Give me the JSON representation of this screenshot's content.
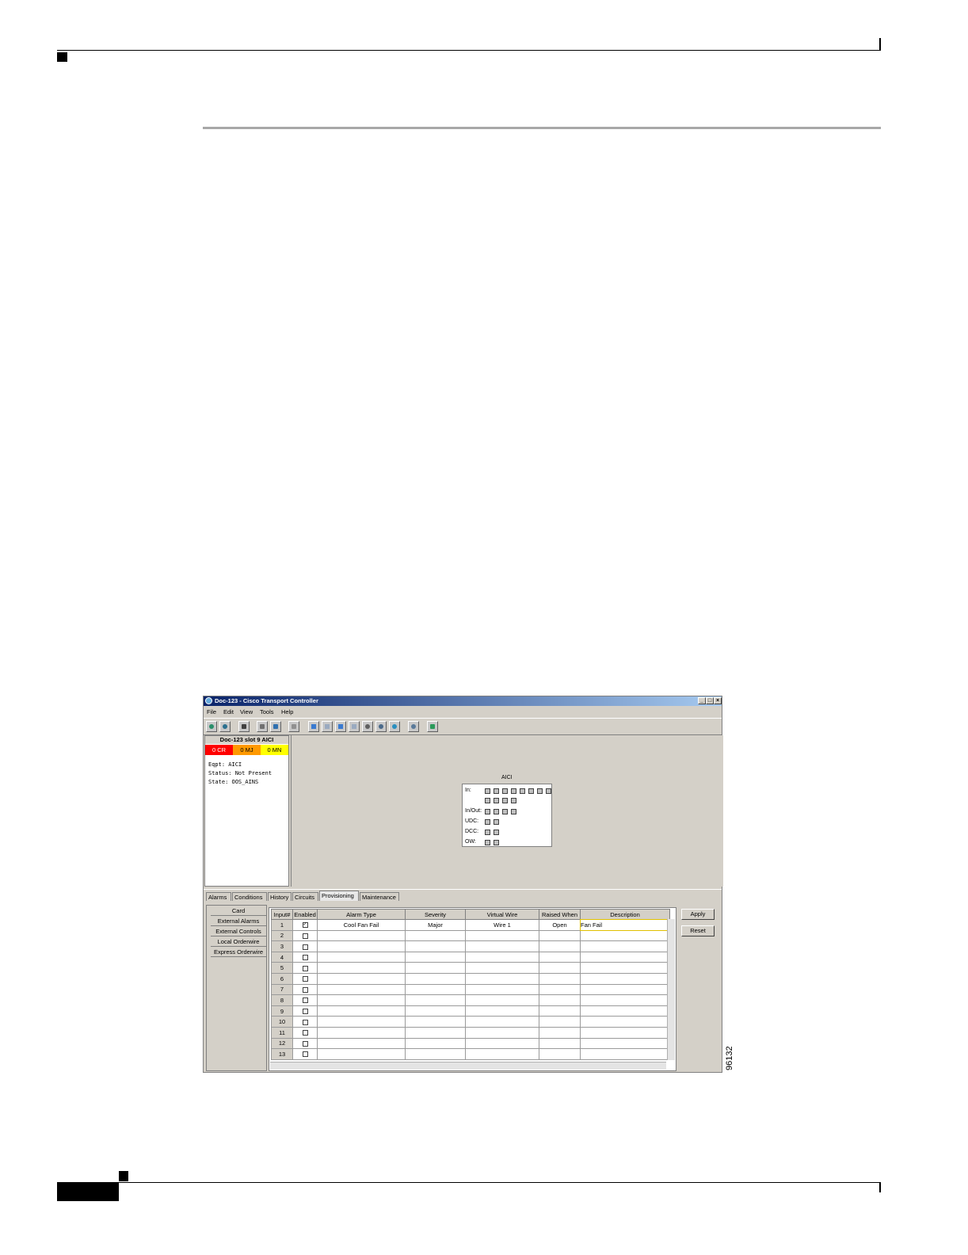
{
  "figure": {
    "number": "96132"
  },
  "window": {
    "title": "Doc-123 - Cisco Transport Controller",
    "controls": {
      "minimize": "_",
      "maximize": "□",
      "close": "×"
    }
  },
  "menu": [
    "File",
    "Edit",
    "View",
    "Tools",
    "Help"
  ],
  "card": {
    "header": "Doc-123 slot 9 AICI",
    "alarms": {
      "critical": "0 CR",
      "major": "0 MJ",
      "minor": "0 MN"
    },
    "info": [
      "Eqpt: AICI",
      "Status: Not Present",
      "State: OOS_AINS"
    ],
    "alarm_colors": {
      "critical": "#ff0000",
      "major": "#ff9900",
      "minor": "#ffff00"
    }
  },
  "aici_view": {
    "title": "AICI",
    "rows": [
      "In:",
      "In/Out:",
      "UDC:",
      "DCC:",
      "OW:"
    ]
  },
  "tabs": [
    "Alarms",
    "Conditions",
    "History",
    "Circuits",
    "Provisioning",
    "Maintenance"
  ],
  "active_tab": "Provisioning",
  "subtabs": [
    "Card",
    "External Alarms",
    "External Controls",
    "Local Orderwire",
    "Express Orderwire"
  ],
  "table": {
    "headers": [
      "Input#",
      "Enabled",
      "Alarm Type",
      "Severity",
      "Virtual Wire",
      "Raised When",
      "Description"
    ],
    "rows": [
      {
        "input": "1",
        "enabled": true,
        "alarm_type": "Cool Fan Fail",
        "severity": "Major",
        "virtual_wire": "Wire 1",
        "raised_when": "Open",
        "description": "Fan Fail"
      },
      {
        "input": "2",
        "enabled": false
      },
      {
        "input": "3",
        "enabled": false
      },
      {
        "input": "4",
        "enabled": false
      },
      {
        "input": "5",
        "enabled": false
      },
      {
        "input": "6",
        "enabled": false
      },
      {
        "input": "7",
        "enabled": false
      },
      {
        "input": "8",
        "enabled": false
      },
      {
        "input": "9",
        "enabled": false
      },
      {
        "input": "10",
        "enabled": false
      },
      {
        "input": "11",
        "enabled": false
      },
      {
        "input": "12",
        "enabled": false
      },
      {
        "input": "13",
        "enabled": false
      }
    ]
  },
  "buttons": {
    "apply": "Apply",
    "reset": "Reset"
  }
}
